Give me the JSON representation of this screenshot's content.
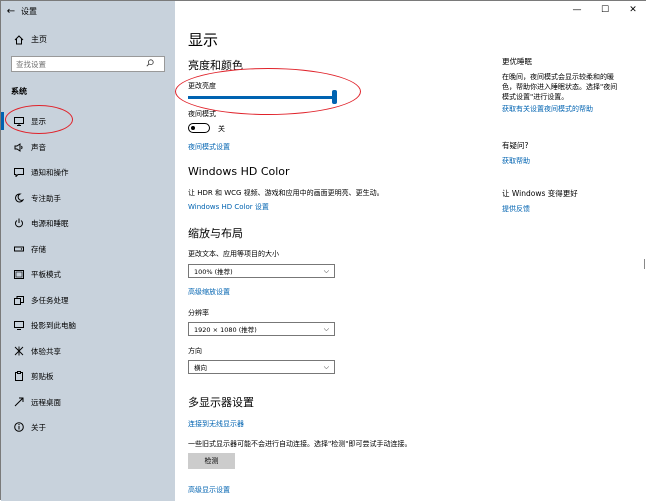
{
  "window": {
    "title": "设置",
    "min": "—",
    "max": "☐",
    "close": "✕"
  },
  "sidebar": {
    "home_label": "主页",
    "search_placeholder": "查找设置",
    "section": "系统",
    "items": [
      {
        "label": "显示",
        "icon": "monitor-icon",
        "active": true
      },
      {
        "label": "声音",
        "icon": "speaker-icon"
      },
      {
        "label": "通知和操作",
        "icon": "notification-icon"
      },
      {
        "label": "专注助手",
        "icon": "moon-icon"
      },
      {
        "label": "电源和睡眠",
        "icon": "power-icon"
      },
      {
        "label": "存储",
        "icon": "storage-icon"
      },
      {
        "label": "平板模式",
        "icon": "tablet-icon"
      },
      {
        "label": "多任务处理",
        "icon": "multitask-icon"
      },
      {
        "label": "投影到此电脑",
        "icon": "projection-icon"
      },
      {
        "label": "体验共享",
        "icon": "share-icon"
      },
      {
        "label": "剪贴板",
        "icon": "clipboard-icon"
      },
      {
        "label": "远程桌面",
        "icon": "remote-icon"
      },
      {
        "label": "关于",
        "icon": "info-icon"
      }
    ]
  },
  "main": {
    "title": "显示",
    "brightness_section": "亮度和颜色",
    "brightness_label": "更改亮度",
    "brightness_value": 1.0,
    "nightlight_label": "夜间模式",
    "nightlight_state": "关",
    "nightlight_link": "夜间模式设置",
    "hdr_title": "Windows HD Color",
    "hdr_desc": "让 HDR 和 WCG 视频、游戏和应用中的画面更明亮、更生动。",
    "hdr_link": "Windows HD Color 设置",
    "scale_title": "缩放与布局",
    "scale_label": "更改文本、应用等项目的大小",
    "scale_value": "100% (推荐)",
    "scale_link": "高级缩放设置",
    "resolution_label": "分辨率",
    "resolution_value": "1920 × 1080 (推荐)",
    "orientation_label": "方向",
    "orientation_value": "横向",
    "multi_title": "多显示器设置",
    "wireless_link": "连接到无线显示器",
    "detect_desc": "一些旧式显示器可能不会进行自动连接。选择\"检测\"即可尝试手动连接。",
    "detect_button": "检测",
    "advanced_link": "高级显示设置"
  },
  "right": {
    "sleep_title": "更优睡眠",
    "sleep_desc_1": "在晚间，夜间模式会显示较柔和的暖",
    "sleep_desc_2": "色，帮助你进入睡眠状态。选择\"夜间",
    "sleep_desc_3": "模式设置\"进行设置。",
    "sleep_link": "获取有关设置夜间模式的帮助",
    "question_title": "有疑问?",
    "question_link": "获取帮助",
    "better_title": "让 Windows 变得更好",
    "better_link": "提供反馈"
  },
  "colors": {
    "accent": "#0063b1",
    "sidebar_bg": "#c8d2dc",
    "annotation": "#e0222a"
  }
}
